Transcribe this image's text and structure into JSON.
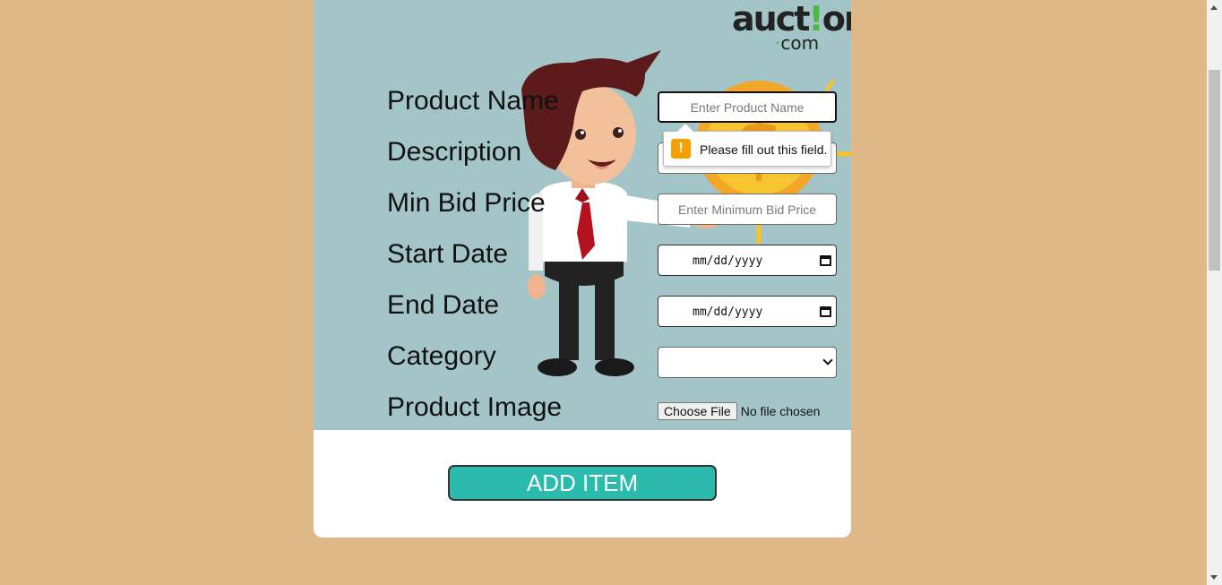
{
  "logo": {
    "word_prefix": "auct",
    "word_bang": "!",
    "word_suffix": "on",
    "domain_prefix": "",
    "domain_dot": "·",
    "domain_text": "com"
  },
  "form": {
    "labels": {
      "product_name": "Product Name",
      "description": "Description",
      "min_bid": "Min Bid Price",
      "start_date": "Start Date",
      "end_date": "End Date",
      "category": "Category",
      "product_image": "Product Image"
    },
    "placeholders": {
      "product_name": "Enter Product Name",
      "min_bid": "Enter Minimum Bid Price"
    },
    "date_format": "mm/dd/yyyy",
    "category_value": "",
    "file_button": "Choose File",
    "file_status": "No file chosen",
    "submit": "ADD ITEM"
  },
  "validation": {
    "message": "Please fill out this field.",
    "icon": "!"
  },
  "colors": {
    "background": "#dfb887",
    "panel": "#a4c5c8",
    "accent": "#2bbbad",
    "warning": "#f5a000"
  }
}
